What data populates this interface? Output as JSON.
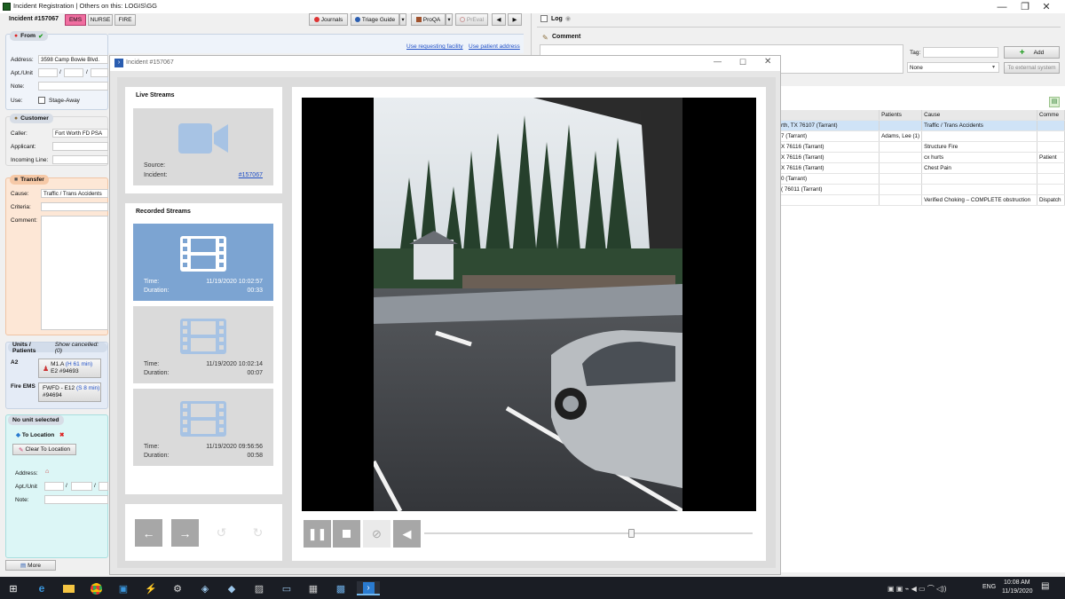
{
  "titlebar": {
    "title": "Incident Registration | Others on this: LOGIS\\GG",
    "min": "—",
    "restore": "❐",
    "close": "✕"
  },
  "toolbar": {
    "incident": "Incident #157067",
    "tabs": [
      "EMS",
      "NURSE",
      "FIRE"
    ],
    "journals": "Journals",
    "triage": "Triage Guide",
    "proqa": "ProQA",
    "preval": "PrEval"
  },
  "from": {
    "title": "From",
    "address_label": "Address:",
    "address_value": "3598 Camp Bowie Blvd.",
    "apt_label": "Apt./Unit",
    "note_label": "Note:",
    "use_label": "Use:",
    "stage_away": "Stage-Away",
    "link_requesting": "Use requesting facility",
    "link_patient": "Use patient address"
  },
  "customer": {
    "title": "Customer",
    "caller_label": "Caller:",
    "caller_value": "Fort Worth FD PSA",
    "applicant_label": "Applicant:",
    "incoming_label": "Incoming Line:"
  },
  "transfer": {
    "title": "Transfer",
    "cause_label": "Cause:",
    "cause_value": "Traffic / Trans Accidents",
    "criteria_label": "Criteria:",
    "comment_label": "Comment:"
  },
  "units": {
    "title": "Units / Patients",
    "show_cancelled": "Show cancelled: (0)",
    "a2_label": "A2",
    "unit1_line1": "M1.A",
    "unit1_time": "(H 61 min)",
    "unit1_line2": "E2 #94693",
    "fire_label": "Fire EMS",
    "unit2_line1": "FWFD - E12",
    "unit2_time": "(S 8 min)",
    "unit2_line2": "#94694"
  },
  "no_unit": {
    "title": "No unit selected",
    "to_location": "To Location",
    "clear_button": "Clear To Location",
    "address_label": "Address:",
    "apt_label": "Apt./Unit",
    "note_label": "Note:"
  },
  "more_button": "More",
  "log": {
    "title": "Log",
    "comment_title": "Comment",
    "tag_label": "Tag:",
    "add_button": "Add",
    "none_option": "None",
    "external_button": "To external system"
  },
  "results": {
    "headers": [
      "",
      "Patients",
      "Cause",
      "Comme"
    ],
    "rows": [
      [
        "rth, TX 76107 (Tarrant)",
        "",
        "Traffic / Trans Accidents",
        ""
      ],
      [
        "7 (Tarrant)",
        "Adams, Lee (1)",
        "",
        ""
      ],
      [
        "X 76116 (Tarrant)",
        "",
        "Structure Fire",
        ""
      ],
      [
        "X 76116 (Tarrant)",
        "",
        "cx hurts",
        "Patient"
      ],
      [
        "X 76116 (Tarrant)",
        "",
        "Chest Pain",
        ""
      ],
      [
        "0 (Tarrant)",
        "",
        "",
        ""
      ],
      [
        "( 76011 (Tarrant)",
        "",
        "",
        ""
      ],
      [
        "",
        "",
        "Verified Choking – COMPLETE obstruction",
        "Dispatch"
      ]
    ]
  },
  "dialog": {
    "title": "Incident #157067",
    "live_title": "Live Streams",
    "live_source_label": "Source:",
    "live_incident_label": "Incident:",
    "live_incident_link": "#157067",
    "recorded_title": "Recorded Streams",
    "time_label": "Time:",
    "duration_label": "Duration:",
    "recordings": [
      {
        "time": "11/19/2020 10:02:57",
        "duration": "00:33",
        "selected": true
      },
      {
        "time": "11/19/2020 10:02:14",
        "duration": "00:07",
        "selected": false
      },
      {
        "time": "11/19/2020 09:56:56",
        "duration": "00:58",
        "selected": false
      }
    ],
    "nav_icons": [
      "arrow-left-icon",
      "arrow-right-icon",
      "rotate-left-icon",
      "rotate-right-icon"
    ],
    "video_controls": [
      "pause-icon",
      "stop-icon",
      "camera-off-icon",
      "volume-icon"
    ],
    "seek_progress": 0.63,
    "accent": "#7ca4d2"
  },
  "taskbar": {
    "clock_time": "10:08 AM",
    "clock_date": "11/19/2020",
    "lang": "ENG"
  }
}
